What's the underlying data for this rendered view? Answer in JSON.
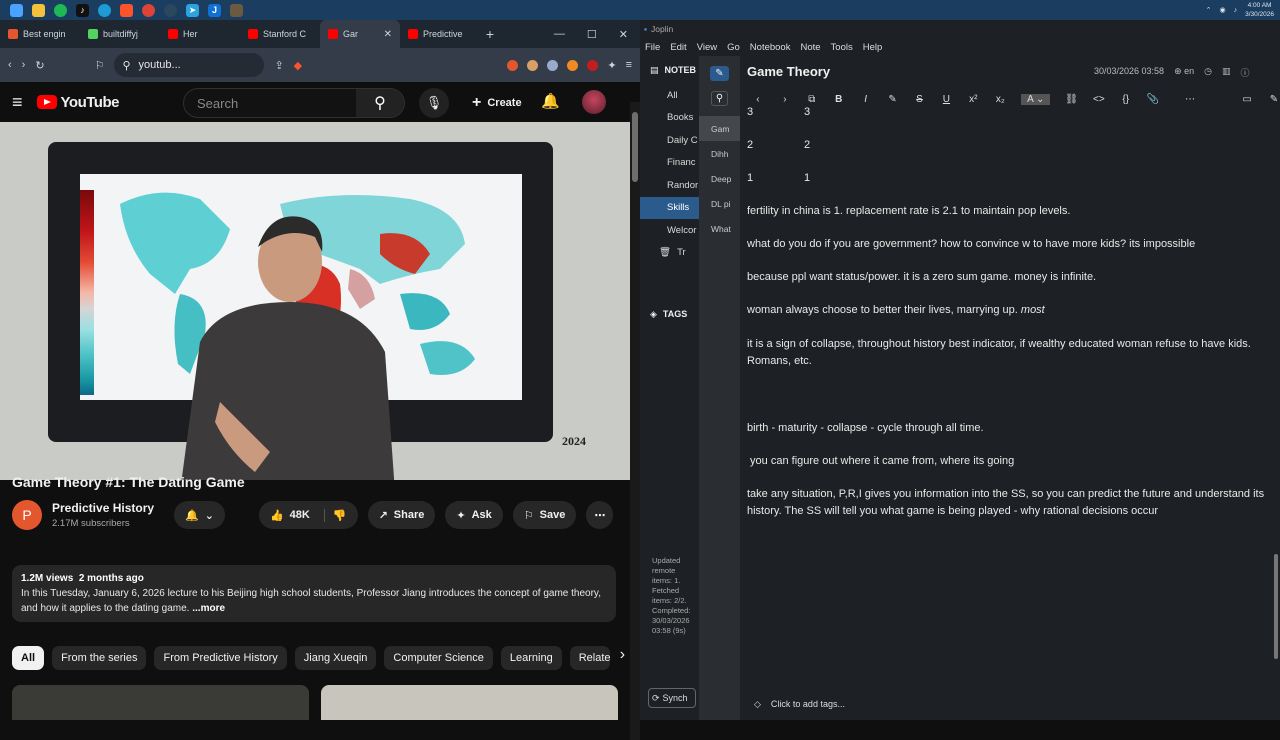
{
  "taskbar": {
    "clock_time": "4:00 AM",
    "clock_date": "3/30/2026"
  },
  "browser": {
    "tabs": [
      {
        "title": "Best engin",
        "color": "#e4572e"
      },
      {
        "title": "builtdiffyj",
        "color": "#55d35f"
      },
      {
        "title": "Her",
        "color": "#ff0000"
      },
      {
        "title": "Stanford C",
        "color": "#ff0000"
      },
      {
        "title": "Gar",
        "color": "#ff0000"
      },
      {
        "title": "Predictive",
        "color": "#ff0000"
      }
    ],
    "url": "youtub...",
    "search_placeholder": "Search",
    "create_label": "Create",
    "logo_text": "YouTube"
  },
  "video": {
    "year_label": "2024",
    "title": "Game Theory #1: The Dating Game",
    "channel": "Predictive History",
    "subscribers": "2.17M subscribers",
    "likes": "48K",
    "share": "Share",
    "ask": "Ask",
    "save": "Save",
    "views": "1.2M views",
    "age": "2 months ago",
    "description": "In this Tuesday, January 6, 2026 lecture to his Beijing high school students, Professor Jiang introduces the concept of game theory, and how it applies to the dating game.",
    "more": "...more",
    "chips": [
      "All",
      "From the series",
      "From Predictive History",
      "Jiang Xueqin",
      "Computer Science",
      "Learning",
      "Relate"
    ]
  },
  "joplin": {
    "window_title": "Joplin",
    "menu": [
      "File",
      "Edit",
      "View",
      "Go",
      "Notebook",
      "Note",
      "Tools",
      "Help"
    ],
    "notebooks": [
      "All",
      "Books",
      "Daily C",
      "Financ",
      "Randor",
      "Skills",
      "Welcor",
      "Tr"
    ],
    "notebooks_header": "NOTEB",
    "tags_header": "TAGS",
    "notes": [
      "Gam",
      "Dihh",
      "Deep",
      "DL pi",
      "What"
    ],
    "sync_status": "Updated remote items: 1. Fetched items: 2/2. Completed: 30/03/2026 03:58 (9s)",
    "sync_button": "Synch",
    "note_title": "Game Theory",
    "note_date": "30/03/2026 03:58",
    "note_lang": "en",
    "add_tags": "Click to add tags...",
    "lines": [
      {
        "a": "3",
        "b": "3"
      },
      {
        "a": "2",
        "b": "2"
      },
      {
        "a": "1",
        "b": "1"
      }
    ],
    "paragraphs": [
      "fertility in china is 1. replacement rate is 2.1 to maintain pop levels.",
      "what do you do if you are government? how to convince w to have more kids? its impossible",
      "because ppl want status/power. it is a zero sum game. money is infinite.",
      "woman always choose to better their lives, marrying up.",
      "it is a sign of collapse, throughout history best indicator, if wealthy educated woman refuse to have kids. Romans, etc.",
      "birth - maturity - collapse - cycle through all time.",
      " you can figure out where it came from, where its going",
      "take any situation, P,R,I gives you information into the SS, so you can predict the future and understand its history. The SS will tell you what game is being played - why rational decisions occur"
    ],
    "emphasis": "most"
  }
}
